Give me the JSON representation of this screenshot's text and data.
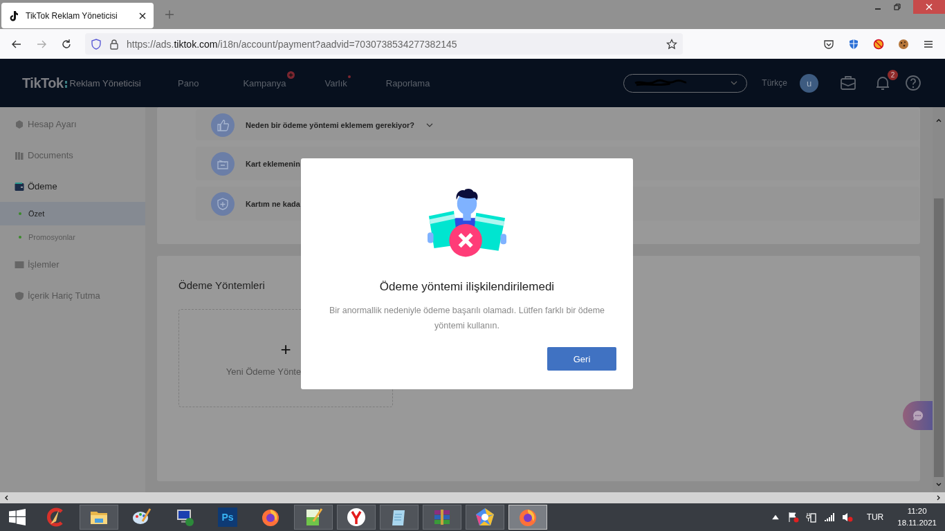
{
  "browser": {
    "tab": {
      "title": "TikTok Reklam Yöneticisi"
    },
    "url": {
      "prefix": "https://ads.",
      "domain": "tiktok.com",
      "path": "/i18n/account/payment?aadvid=7030738534277382145"
    }
  },
  "header": {
    "logo": "TikTok",
    "logo_sub": "Reklam Yöneticisi",
    "nav": [
      {
        "label": "Pano",
        "kind": "plain"
      },
      {
        "label": "Kampanya",
        "kind": "plus"
      },
      {
        "label": "Varlık",
        "kind": "dot"
      },
      {
        "label": "Raporlama",
        "kind": "plain"
      }
    ],
    "language": "Türkçe",
    "avatar": "u",
    "notifications": "2"
  },
  "sidebar": {
    "items": [
      {
        "label": "Hesap Ayarı",
        "kind": "gear",
        "selected": false
      },
      {
        "label": "Documents",
        "kind": "books",
        "selected": false
      },
      {
        "label": "Ödeme",
        "kind": "wallet",
        "selected": true,
        "children": [
          {
            "label": "Özet",
            "selected": true
          },
          {
            "label": "Promosyonlar",
            "selected": false
          }
        ]
      },
      {
        "label": "İşlemler",
        "kind": "bars",
        "selected": false
      },
      {
        "label": "İçerik Hariç Tutma",
        "kind": "shield",
        "selected": false
      }
    ]
  },
  "faq": [
    {
      "text": "Neden bir ödeme yöntemi eklemem gerekiyor?",
      "kind": "thumb",
      "expandable": true
    },
    {
      "text": "Kart eklemenin",
      "kind": "card",
      "expandable": false
    },
    {
      "text": "Kartım ne kada",
      "kind": "shield",
      "expandable": false
    }
  ],
  "payment_methods": {
    "title": "Ödeme Yöntemleri",
    "add_symbol": "+",
    "add_label": "Yeni Ödeme Yönte"
  },
  "modal": {
    "title": "Ödeme yöntemi ilişkilendirilemedi",
    "message": "Bir anormallik nedeniyle ödeme başarılı olamadı. Lütfen farklı bir ödeme yöntemi kullanın.",
    "button": "Geri"
  },
  "taskbar": {
    "apps": [
      {
        "kind": "ccleaner",
        "open": false,
        "selected": false
      },
      {
        "kind": "explorer",
        "open": true,
        "selected": false
      },
      {
        "kind": "paint",
        "open": false,
        "selected": false
      },
      {
        "kind": "remote",
        "open": false,
        "selected": false
      },
      {
        "kind": "photoshop",
        "label": "Ps",
        "open": false,
        "selected": false
      },
      {
        "kind": "firefox",
        "open": false,
        "selected": false
      },
      {
        "kind": "notepadpp",
        "open": true,
        "selected": false
      },
      {
        "kind": "yandex",
        "open": true,
        "selected": false
      },
      {
        "kind": "notepad",
        "open": true,
        "selected": false
      },
      {
        "kind": "winrar",
        "open": true,
        "selected": false
      },
      {
        "kind": "photos",
        "open": true,
        "selected": false
      },
      {
        "kind": "firefox",
        "open": true,
        "selected": true
      }
    ],
    "language": "TUR",
    "time": "11:20",
    "date": "18.11.2021"
  }
}
